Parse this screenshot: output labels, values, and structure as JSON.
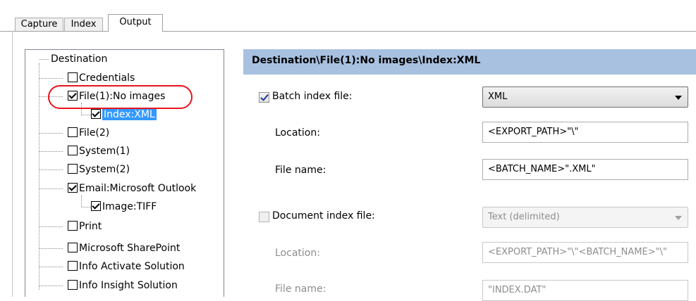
{
  "tabs": [
    {
      "label": "Capture"
    },
    {
      "label": "Index"
    },
    {
      "label": "Output"
    }
  ],
  "tree": {
    "root_label": "Destination",
    "items": [
      {
        "label": "Credentials",
        "checked": false
      },
      {
        "label": "File(1):No images",
        "checked": true
      },
      {
        "label": "Index:XML",
        "checked": true,
        "selected": true
      },
      {
        "label": "File(2)",
        "checked": false
      },
      {
        "label": "System(1)",
        "checked": false
      },
      {
        "label": "System(2)",
        "checked": false
      },
      {
        "label": "Email:Microsoft Outlook",
        "checked": true
      },
      {
        "label": "Image:TIFF",
        "checked": true
      },
      {
        "label": "Print",
        "checked": false
      },
      {
        "label": "Microsoft SharePoint",
        "checked": false
      },
      {
        "label": "Info Activate Solution",
        "checked": false
      },
      {
        "label": "Info Insight Solution",
        "checked": false
      }
    ]
  },
  "panel": {
    "header": "Destination\\File(1):No images\\Index:XML",
    "batch": {
      "label": "Batch index file:",
      "checked": true,
      "format": "XML",
      "location_label": "Location:",
      "location_value": "<EXPORT_PATH>\"\\\"",
      "filename_label": "File name:",
      "filename_value": "<BATCH_NAME>\".XML\""
    },
    "document": {
      "label": "Document index file:",
      "checked": false,
      "format": "Text (delimited)",
      "location_label": "Location:",
      "location_value": "<EXPORT_PATH>\"\\\"<BATCH_NAME>\"\\\"",
      "filename_label": "File name:",
      "filename_value": "\"INDEX.DAT\""
    }
  },
  "colors": {
    "header_bg": "#a9c1e0",
    "selection": "#3399ff",
    "annotation": "#e8141c"
  }
}
